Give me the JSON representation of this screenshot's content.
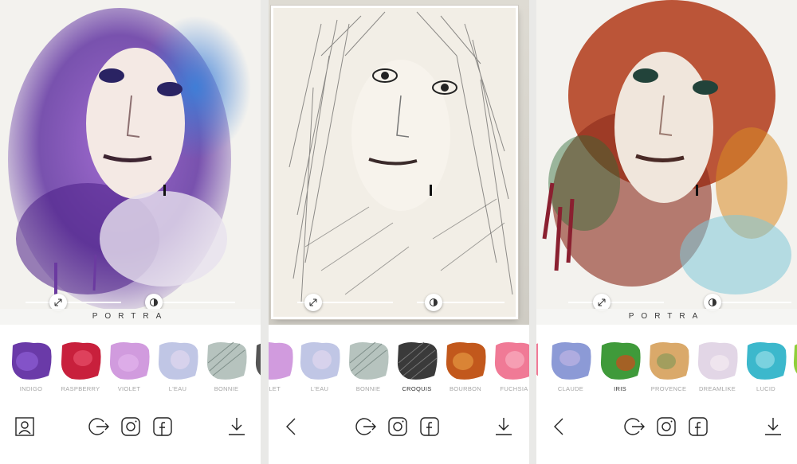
{
  "panels": [
    {
      "caption": "PORTRA",
      "filters": [
        {
          "name": "INDIGO",
          "active": false
        },
        {
          "name": "RASPBERRY",
          "active": false
        },
        {
          "name": "VIOLET",
          "active": false
        },
        {
          "name": "L'EAU",
          "active": false
        },
        {
          "name": "BONNIE",
          "active": false
        }
      ]
    },
    {
      "caption": "",
      "filters": [
        {
          "name": "ÉLET",
          "active": false
        },
        {
          "name": "L'EAU",
          "active": false
        },
        {
          "name": "BONNIE",
          "active": false
        },
        {
          "name": "CROQUIS",
          "active": true
        },
        {
          "name": "BOURBON",
          "active": false
        },
        {
          "name": "FUCHSIA",
          "active": false
        }
      ]
    },
    {
      "caption": "PORTRA",
      "filters": [
        {
          "name": "CLAUDE",
          "active": false
        },
        {
          "name": "IRIS",
          "active": true
        },
        {
          "name": "PROVENCE",
          "active": false
        },
        {
          "name": "DREAMLIKE",
          "active": false
        },
        {
          "name": "LUCID",
          "active": false
        }
      ]
    }
  ],
  "colors": {
    "indigo": "#6a3aa8",
    "raspberry": "#c8203c",
    "violet": "#c98ad8",
    "leau": "#b9c0e2",
    "bonnie": "#a9b8b3",
    "croquis": "#3a3a3a",
    "bourbon": "#c2581c",
    "fuchsia": "#f07a96",
    "claude": "#8c9ad6",
    "iris": "#3f9a3a",
    "provence": "#d6a05a",
    "dreamlike": "#e2d6e6",
    "lucid": "#3cb8cc"
  },
  "icons": {
    "profile": "profile-icon",
    "share": "share-icon",
    "instagram": "instagram-icon",
    "facebook": "facebook-icon",
    "download": "download-icon",
    "back": "back-chevron-icon",
    "size": "resize-arrows-icon",
    "contrast": "contrast-icon"
  }
}
